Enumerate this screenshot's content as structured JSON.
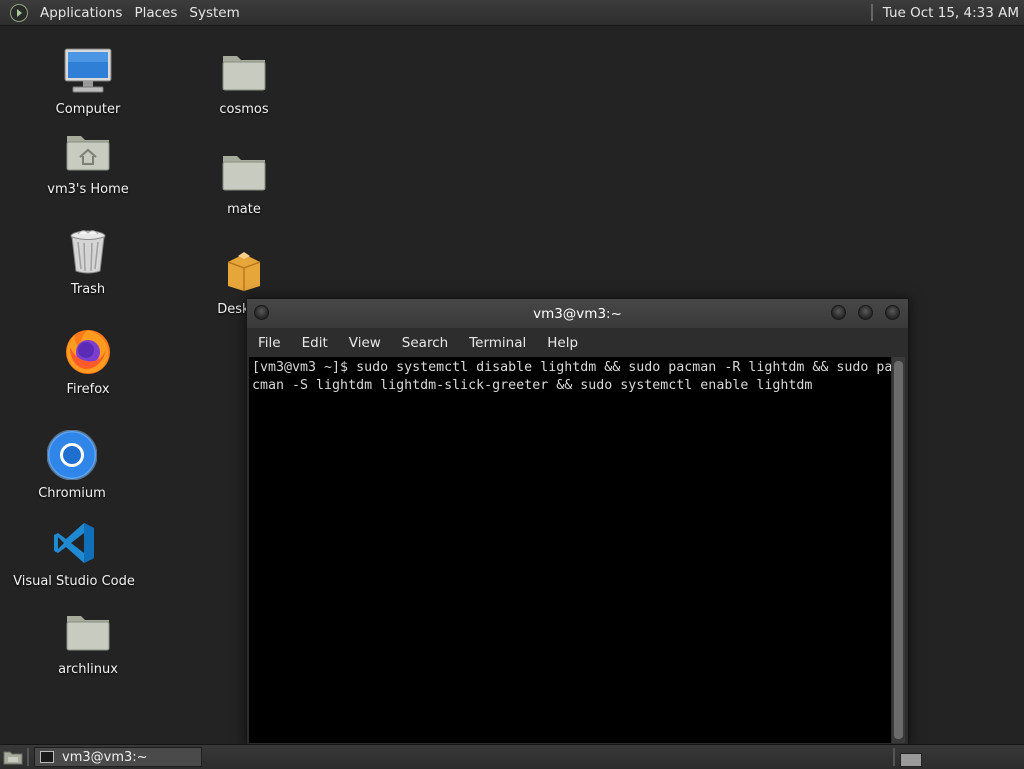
{
  "top_panel": {
    "menus": [
      "Applications",
      "Places",
      "System"
    ],
    "clock": "Tue Oct 15,  4:33 AM"
  },
  "desktop": {
    "icons": [
      {
        "label": "Computer",
        "icon": "computer-icon"
      },
      {
        "label": "vm3's Home",
        "icon": "home-folder-icon"
      },
      {
        "label": "Trash",
        "icon": "trash-icon"
      },
      {
        "label": "Firefox",
        "icon": "firefox-icon"
      },
      {
        "label": "Chromium",
        "icon": "chromium-icon"
      },
      {
        "label": "Visual Studio Code",
        "icon": "vscode-icon"
      },
      {
        "label": "archlinux",
        "icon": "folder-icon"
      },
      {
        "label": "cosmos",
        "icon": "folder-icon"
      },
      {
        "label": "mate",
        "icon": "folder-icon"
      },
      {
        "label": "Desktop",
        "icon": "package-icon"
      }
    ]
  },
  "terminal": {
    "title": "vm3@vm3:~",
    "menu": [
      "File",
      "Edit",
      "View",
      "Search",
      "Terminal",
      "Help"
    ],
    "lines": [
      "[vm3@vm3 ~]$ sudo systemctl disable lightdm && sudo pacman -R lightdm && sudo pa",
      "cman -S lightdm lightdm-slick-greeter && sudo systemctl enable lightdm"
    ]
  },
  "taskbar": {
    "task_label": "vm3@vm3:~"
  },
  "colors": {
    "desktop_bg": "#232323",
    "panel_bg": "#333333",
    "terminal_bg": "#000000",
    "terminal_text": "#d8d8d8"
  }
}
